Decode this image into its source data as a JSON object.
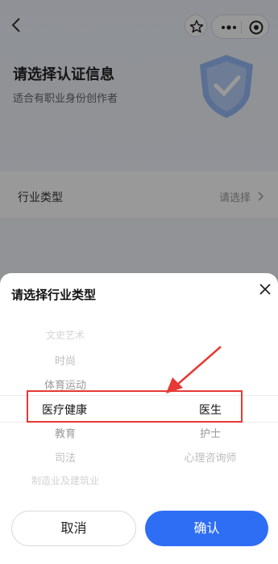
{
  "page": {
    "title": "请选择认证信息",
    "subtitle": "适合有职业身份创作者",
    "industry_row": {
      "label": "行业类型",
      "value": "请选择"
    }
  },
  "sheet": {
    "title": "请选择行业类型",
    "left_column": {
      "above": [
        "文史艺术",
        "时尚",
        "体育运动"
      ],
      "selected": "医疗健康",
      "below": [
        "教育",
        "司法",
        "制造业及建筑业"
      ]
    },
    "right_column": {
      "selected": "医生",
      "below": [
        "护士",
        "心理咨询师"
      ]
    },
    "cancel_label": "取消",
    "confirm_label": "确认"
  },
  "colors": {
    "accent": "#2e6ef5",
    "annotation": "#e53a35"
  },
  "icons": {
    "back": "chevron-left-icon",
    "star": "star-icon",
    "more": "more-dots-icon",
    "mini_close": "target-icon",
    "sheet_close": "close-icon",
    "row_chevron": "chevron-right-icon"
  }
}
